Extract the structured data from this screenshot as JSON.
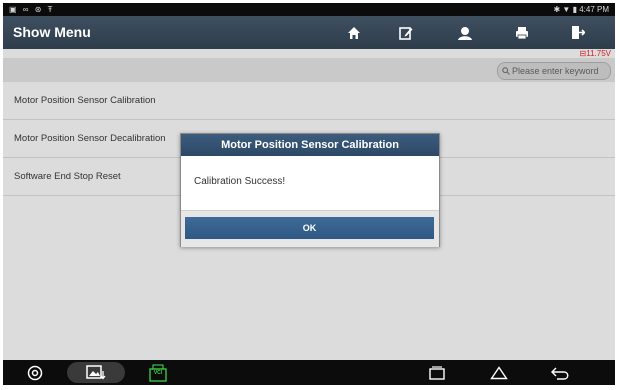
{
  "status_bar": {
    "left_icons": [
      "image-icon",
      "voicemail-icon",
      "settings-icon",
      "usb-icon"
    ],
    "right_icons": [
      "bluetooth-icon",
      "wifi-icon",
      "battery-icon"
    ],
    "time": "4:47 PM"
  },
  "header": {
    "title": "Show Menu",
    "buttons": [
      "home-icon",
      "edit-icon",
      "person-icon",
      "print-icon",
      "exit-icon"
    ],
    "voltage": "11.75V"
  },
  "search": {
    "placeholder": "Please enter keyword"
  },
  "menu": {
    "items": [
      {
        "label": "Motor Position Sensor Calibration"
      },
      {
        "label": "Motor Position Sensor Decalibration"
      },
      {
        "label": "Software End Stop Reset"
      }
    ]
  },
  "dialog": {
    "title": "Motor Position Sensor Calibration",
    "message": "Calibration Success!",
    "ok_label": "OK"
  },
  "bottom_nav": {
    "left": [
      "browser-icon",
      "screenshot-icon",
      "vci-icon"
    ],
    "vci_label": "VCI",
    "right": [
      "recent-apps-icon",
      "home-icon",
      "back-icon"
    ]
  },
  "colors": {
    "titlebar": "#34414f",
    "dialog_header": "#34526f",
    "ok_button": "#37608c",
    "voltage": "#d42020"
  }
}
